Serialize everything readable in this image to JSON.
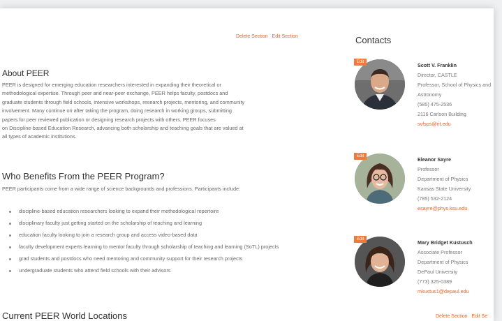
{
  "section_actions": {
    "delete_label": "Delete Section",
    "edit_label": "Edit Section",
    "edit_label_truncated": "Edit Se"
  },
  "about": {
    "title": "About PEER",
    "lines": [
      "PEER is designed for emerging education researchers interested in expanding their theoretical or",
      "methodological expertise. Through peer and near-peer exchange, PEER helps faculty, postdocs and",
      "graduate students through field schools, intensive workshops, research projects, mentoring, and community",
      "involvement. Many continue on after taking the program, doing research in working groups, submitting",
      "papers for peer reviewed publication or designing research projects with others. PEER focuses",
      "on Discipline-based Education Research, advancing both scholarship and teaching goals that are valued at",
      "all types of academic institutions."
    ]
  },
  "who_benefits": {
    "title": "Who Benefits From the PEER Program?",
    "intro": "PEER participants come from a wide range of science backgrounds and professions. Participants include:",
    "items": [
      "discipline-based education researchers looking to expand their methodological repertoire",
      "disciplinary faculty just getting started on the scholarship of teaching and learning",
      "education faculty looking to join a research group and access video-based data",
      "faculty development experts learning to mentor faculty through scholarship of teaching and learning (SoTL) projects",
      "grad students and postdocs who need mentoring and community support for their research projects",
      "undergraduate students who attend field schools with their advisors"
    ]
  },
  "locations": {
    "title": "Current PEER World Locations"
  },
  "contacts": {
    "title": "Contacts",
    "edit_label": "Edit",
    "people": [
      {
        "name": "Scott V. Franklin",
        "lines": [
          "Director, CASTLE",
          "Professor, School of Physics and",
          "Astronomy",
          "(585) 475-2536",
          "2116 Carlson Building"
        ],
        "email": "svfsps@rit.edu"
      },
      {
        "name": "Eleanor Sayre",
        "lines": [
          "Professor",
          "Department of Physics",
          "Kansas State University",
          "(785) 532-2124"
        ],
        "email": "esayre@phys.ksu.edu"
      },
      {
        "name": "Mary Bridget Kustusch",
        "lines": [
          "Associate Professor",
          "Department of Physics",
          "DePaul University",
          "(773) 325-0389"
        ],
        "email": "mkustus1@depaul.edu"
      }
    ]
  },
  "colors": {
    "accent": "#e0652b",
    "edit_tag": "#ee7a3b"
  }
}
